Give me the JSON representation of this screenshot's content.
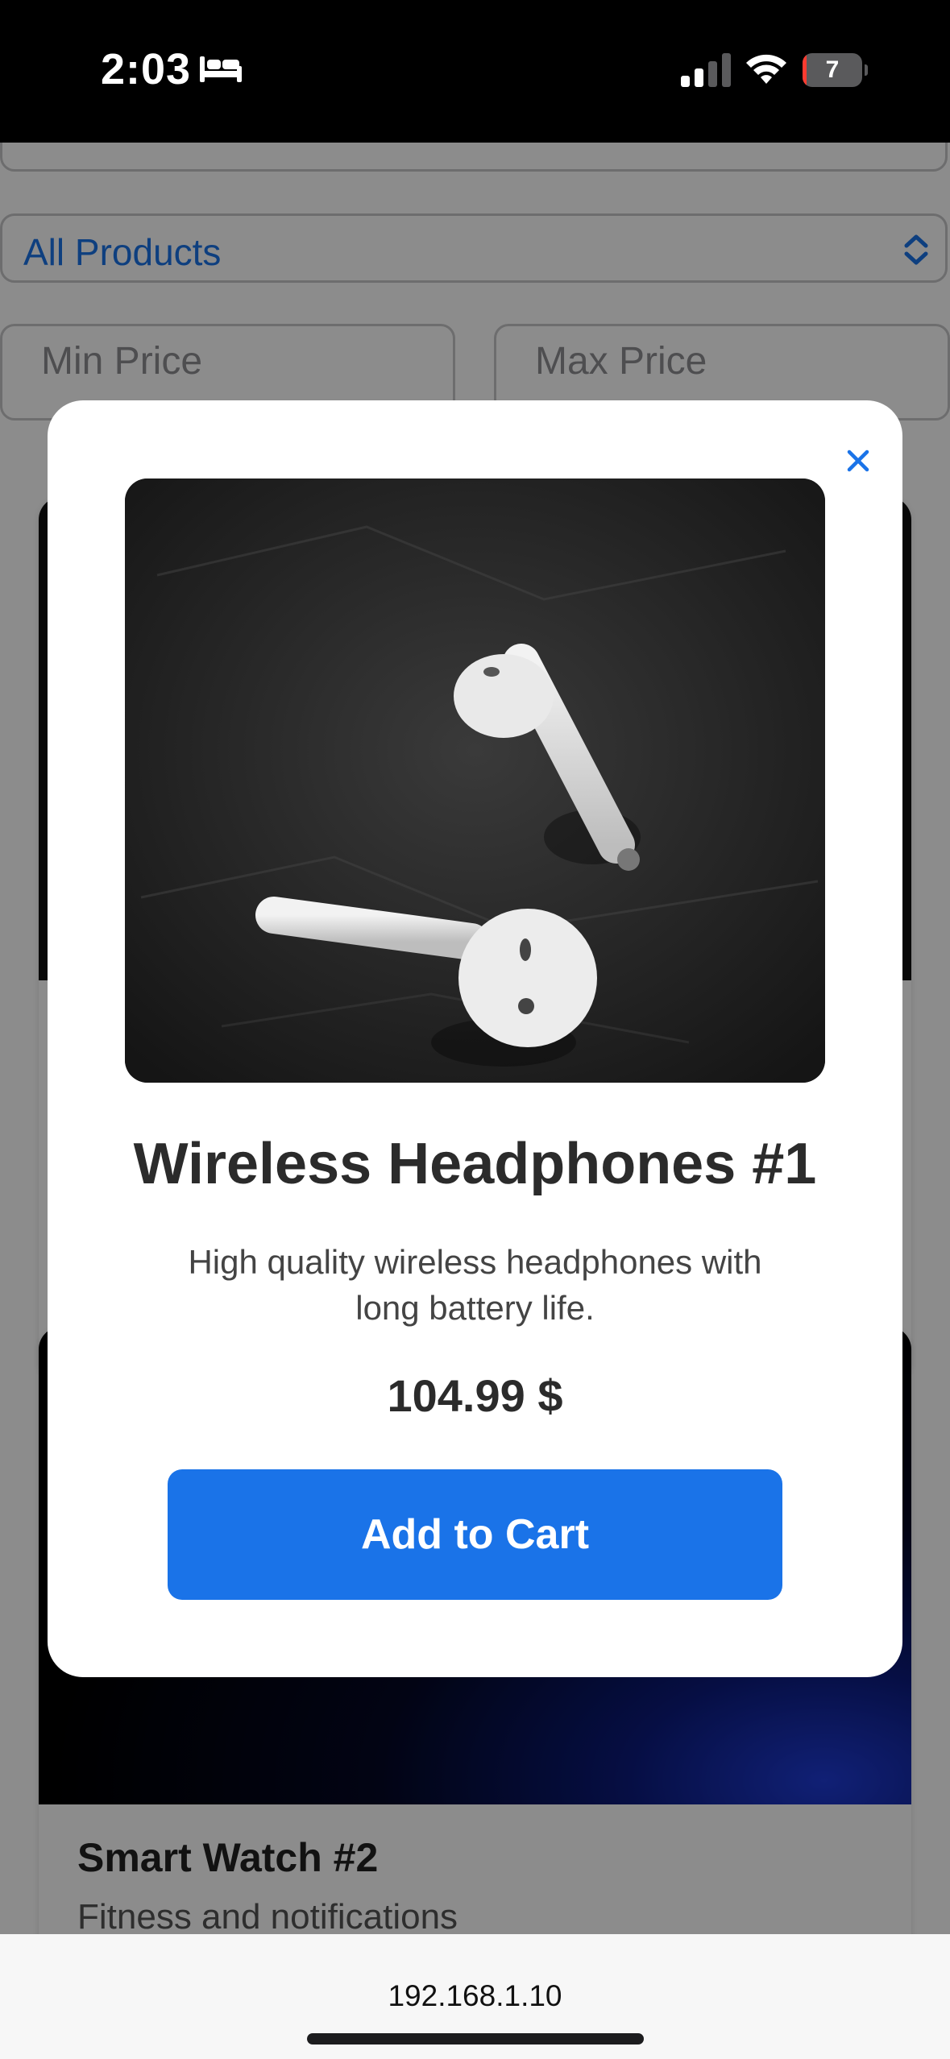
{
  "status_bar": {
    "time": "2:03",
    "sleep_icon": "bed-icon",
    "battery_level": 7,
    "battery_text": "7"
  },
  "page": {
    "category_select": {
      "value": "All Products"
    },
    "min_price": {
      "placeholder": "Min Price"
    },
    "max_price": {
      "placeholder": "Max Price"
    },
    "products": [
      {
        "title": "Smart Watch #2",
        "description": "Fitness and notifications"
      }
    ]
  },
  "modal": {
    "close_icon": "close-icon",
    "title": "Wireless Headphones #1",
    "description": "High quality wireless headphones with long battery life.",
    "price": "104.99 $",
    "add_to_cart": "Add to Cart"
  },
  "browser": {
    "url": "192.168.1.10"
  },
  "colors": {
    "accent": "#1a73e8",
    "battery_low": "#ff3b30"
  }
}
